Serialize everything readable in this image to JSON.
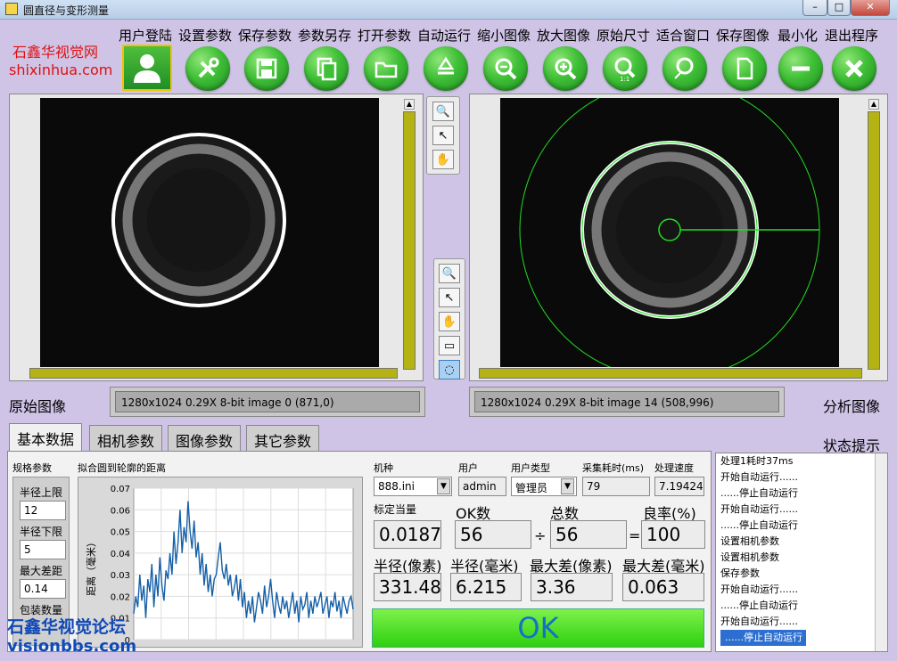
{
  "window": {
    "title": "圆直径与变形测量",
    "min": "–",
    "max": "□",
    "close": "✕"
  },
  "watermark": {
    "cn": "石鑫华视觉网",
    "url": "shixinhua.com",
    "forum_cn": "石鑫华视觉论坛",
    "forum_url": "visionbbs.com"
  },
  "menu": [
    "用户登陆",
    "设置参数",
    "保存参数",
    "参数另存",
    "打开参数",
    "自动运行",
    "缩小图像",
    "放大图像",
    "原始尺寸",
    "适合窗口",
    "保存图像",
    "最小化",
    "退出程序"
  ],
  "toolbar_icons": [
    "user-icon",
    "tools-icon",
    "save-icon",
    "copy-icon",
    "folder-icon",
    "recycle-icon",
    "zoom-out-icon",
    "zoom-in-icon",
    "zoom-1to1-icon",
    "zoom-fit-icon",
    "new-file-icon",
    "minus-icon",
    "close-icon"
  ],
  "left_view": {
    "label": "原始图像",
    "info": "1280x1024 0.29X 8-bit image 0     (871,0)"
  },
  "right_view": {
    "label": "分析图像",
    "info": "1280x1024 0.29X 8-bit image 14     (508,996)"
  },
  "status_title": "状态提示",
  "tabs": [
    "基本数据",
    "相机参数",
    "图像参数",
    "其它参数"
  ],
  "specs": {
    "title": "规格参数",
    "upper_label": "半径上限",
    "upper": "12",
    "lower_label": "半径下限",
    "lower": "5",
    "maxdiff_label": "最大差距",
    "maxdiff": "0.14",
    "pack_label": "包装数量"
  },
  "chart_panel": {
    "title": "拟合圆到轮廓的距离",
    "ylabel": "距离（毫米）"
  },
  "chart_data": {
    "type": "line",
    "title": "拟合圆到轮廓的距离",
    "ylabel": "距离（毫米）",
    "ylim": [
      0,
      0.07
    ],
    "yticks": [
      "0.07",
      "0.06",
      "0.05",
      "0.04",
      "0.03",
      "0.02",
      "0.01",
      "0"
    ],
    "series": [
      {
        "values": [
          0.012,
          0.02,
          0.015,
          0.03,
          0.018,
          0.025,
          0.01,
          0.028,
          0.022,
          0.035,
          0.015,
          0.03,
          0.02,
          0.038,
          0.025,
          0.018,
          0.032,
          0.028,
          0.04,
          0.03,
          0.05,
          0.035,
          0.045,
          0.06,
          0.04,
          0.052,
          0.045,
          0.064,
          0.05,
          0.042,
          0.055,
          0.038,
          0.045,
          0.03,
          0.04,
          0.025,
          0.035,
          0.022,
          0.03,
          0.02,
          0.028,
          0.03,
          0.038,
          0.045,
          0.032,
          0.028,
          0.035,
          0.025,
          0.03,
          0.02,
          0.024,
          0.03,
          0.018,
          0.028,
          0.015,
          0.022,
          0.01,
          0.018,
          0.012,
          0.02,
          0.008,
          0.015,
          0.022,
          0.018,
          0.012,
          0.025,
          0.015,
          0.02,
          0.028,
          0.018,
          0.01,
          0.022,
          0.016,
          0.012,
          0.02,
          0.014,
          0.018,
          0.01,
          0.016,
          0.022,
          0.012,
          0.018,
          0.008,
          0.02,
          0.014,
          0.016,
          0.022,
          0.01,
          0.018,
          0.012,
          0.02,
          0.015,
          0.018,
          0.022,
          0.012,
          0.016,
          0.02,
          0.01,
          0.018,
          0.015,
          0.022,
          0.013,
          0.018,
          0.01,
          0.02,
          0.016,
          0.012,
          0.018,
          0.02,
          0.014
        ]
      }
    ]
  },
  "params": {
    "model_label": "机种",
    "model": "888.ini",
    "user_label": "用户",
    "user": "admin",
    "usertype_label": "用户类型",
    "usertype": "管理员",
    "acq_label": "采集耗时(ms)",
    "acq": "79",
    "speed_label": "处理速度",
    "speed": "7.19424"
  },
  "metrics": {
    "calib_label": "标定当量",
    "calib": "0.0187",
    "ok_label": "OK数",
    "ok": "56",
    "div": "÷",
    "total_label": "总数",
    "total": "56",
    "eq": "=",
    "rate_label": "良率(%)",
    "rate": "100",
    "rpx_label": "半径(像素)",
    "rpx": "331.48",
    "rmm_label": "半径(毫米)",
    "rmm": "6.215",
    "maxpx_label": "最大差(像素)",
    "maxpx": "3.36",
    "maxmm_label": "最大差(毫米)",
    "maxmm": "0.063"
  },
  "result": "OK",
  "status_lines": [
    "处理1耗时37ms",
    "开始自动运行......",
    "......停止自动运行",
    "开始自动运行......",
    "......停止自动运行",
    "设置相机参数",
    "设置相机参数",
    "保存参数",
    "开始自动运行......",
    "......停止自动运行",
    "开始自动运行......",
    "......停止自动运行"
  ]
}
